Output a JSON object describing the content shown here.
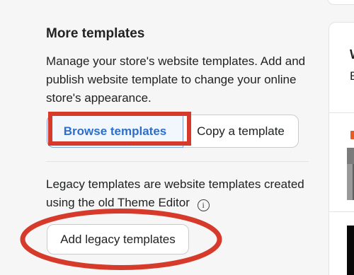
{
  "section": {
    "title": "More templates",
    "description": "Manage your store's website templates. Add and publish website template to change your online store's appearance."
  },
  "actions": {
    "browse_label": "Browse templates",
    "copy_label": "Copy a template"
  },
  "legacy": {
    "text": "Legacy templates are website templates created using the old Theme Editor",
    "info_icon": "info-icon",
    "info_glyph": "i",
    "button_label": "Add legacy templates"
  },
  "right_panel": {
    "heading_fragment": "W",
    "text_fragment": "E"
  },
  "colors": {
    "annotation": "#d63a2b",
    "primary_blue": "#2c6ecb",
    "page_background": "#f6f6f7"
  }
}
